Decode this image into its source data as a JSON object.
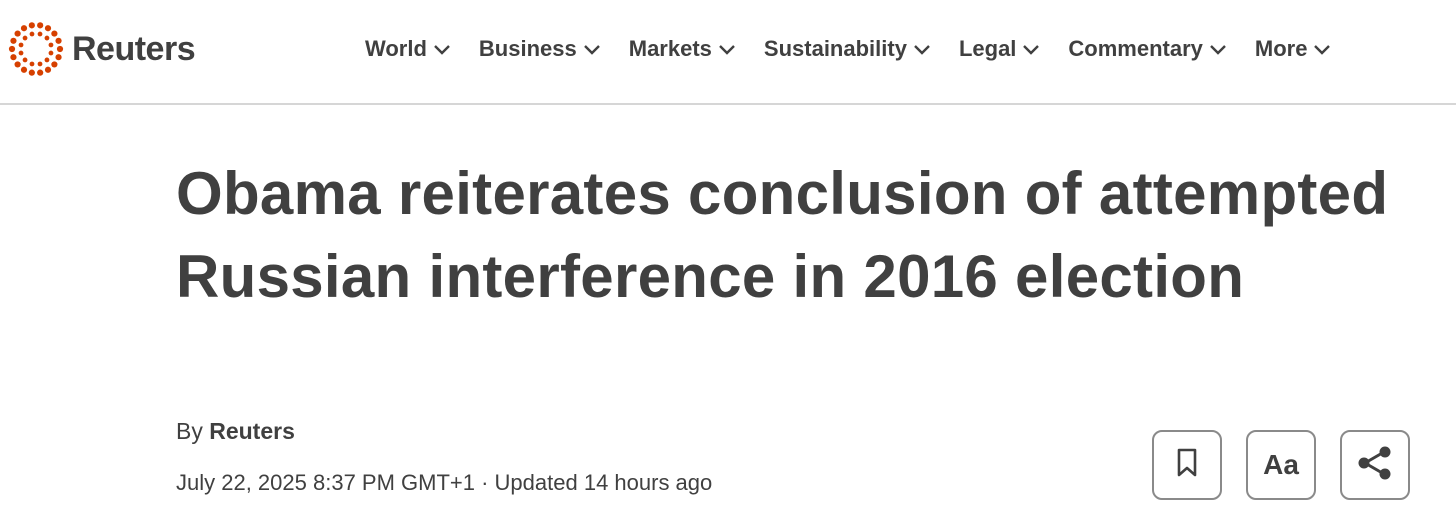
{
  "brand": {
    "name": "Reuters",
    "logo_color": "#d64000"
  },
  "nav": {
    "items": [
      {
        "label": "World",
        "icon": "chevron-down-icon"
      },
      {
        "label": "Business",
        "icon": "chevron-down-icon"
      },
      {
        "label": "Markets",
        "icon": "chevron-down-icon"
      },
      {
        "label": "Sustainability",
        "icon": "chevron-down-icon"
      },
      {
        "label": "Legal",
        "icon": "chevron-down-icon"
      },
      {
        "label": "Commentary",
        "icon": "chevron-down-icon"
      },
      {
        "label": "More",
        "icon": "chevron-down-icon"
      }
    ]
  },
  "article": {
    "headline": "Obama reiterates conclusion of attempted Russian interference in 2016 election",
    "byline_prefix": "By",
    "author": "Reuters",
    "dateline": "July 22, 2025 8:37 PM GMT+1 · Updated 14 hours ago"
  },
  "tools": {
    "save_icon": "bookmark-icon",
    "text_size_label": "Aa",
    "share_icon": "share-icon"
  },
  "colors": {
    "text": "#404040",
    "divider": "#d6d6d6",
    "button_border": "#8a8a8a"
  }
}
